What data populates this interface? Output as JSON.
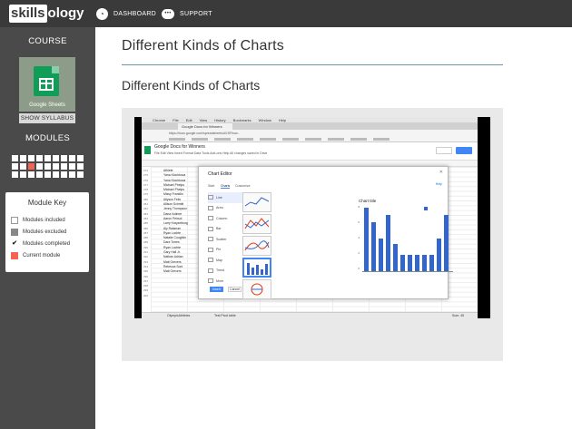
{
  "topbar": {
    "logo_left": "skills",
    "logo_right": "ology",
    "nav": [
      {
        "label": "DASHBOARD",
        "icon": "dashboard-icon"
      },
      {
        "label": "SUPPORT",
        "icon": "chat-bubble-icon"
      }
    ]
  },
  "sidebar": {
    "course_heading": "COURSE",
    "course_name": "Google Sheets",
    "syllabus_button": "SHOW SYLLABUS",
    "modules_heading": "MODULES",
    "module_grid": {
      "columns": 9,
      "rows": 3,
      "current_index": 2
    },
    "module_key": {
      "title": "Module Key",
      "items": [
        {
          "label": "Modules included"
        },
        {
          "label": "Modules excluded"
        },
        {
          "label": "Modules completed"
        },
        {
          "label": "Current module"
        }
      ]
    }
  },
  "main": {
    "title": "Different Kinds of Charts",
    "subtitle": "Different Kinds of Charts"
  },
  "video": {
    "mac_menu": [
      "Chrome",
      "File",
      "Edit",
      "View",
      "History",
      "Bookmarks",
      "Window",
      "Help"
    ],
    "browser_tab": "Google Docs for Winners",
    "url": "https://docs.google.com/spreadsheets/d/1SFhsw...",
    "doc_title": "Google Docs for Winners",
    "doc_menu": "File   Edit   View   Insert   Format   Data   Tools   Add-ons   Help   All changes saved in Drive",
    "row_numbers": [
      "274",
      "275",
      "276",
      "277",
      "278",
      "279",
      "280",
      "281",
      "282",
      "283",
      "284",
      "285",
      "286",
      "287",
      "288",
      "289",
      "290",
      "291",
      "292",
      "293",
      "294",
      "295",
      "296",
      "297",
      "298",
      "299",
      "300"
    ],
    "athletes": [
      "Athlete",
      "Yana Klochkova",
      "Yana Klochkova",
      "Michael Phelps",
      "Michael Phelps",
      "Missy Franklin",
      "Allyson Felix",
      "Allison Schmitt",
      "Jenny Thompson",
      "Dana Vollmer",
      "Aaron Peirsol",
      "Larry Krayzelburg",
      "Aly Raisman",
      "Ryan Lochte",
      "Natalie Coughlin",
      "Dara Torres",
      "Ryan Lochte",
      "Gary Hall Jr.",
      "Nathan Adrian",
      "Matt Grevers",
      "Rebecca Soni",
      "Matt Grevers"
    ],
    "chart_editor": {
      "title": "Chart Editor",
      "tabs": [
        "Start",
        "Charts",
        "Customize"
      ],
      "help": "Help",
      "types": [
        "Line",
        "Area",
        "Column",
        "Bar",
        "Scatter",
        "Pie",
        "Map",
        "Trend",
        "More"
      ],
      "preview_title": "Chart title",
      "preview_ylabels": [
        "8",
        "6",
        "4",
        "2",
        "0"
      ],
      "insert": "Insert",
      "cancel": "Cancel"
    },
    "sheet_tabs": [
      "OlympicAthletes",
      "Test Pivot table"
    ],
    "sum_label": "Sum: 45"
  }
}
